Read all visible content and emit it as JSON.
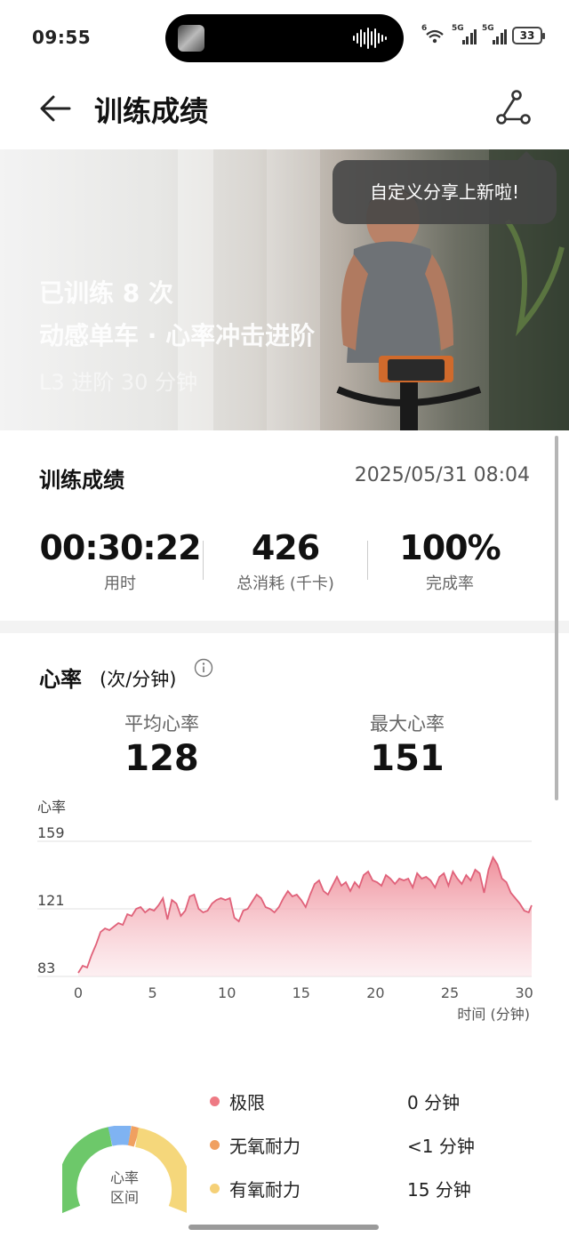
{
  "status_bar": {
    "time": "09:55",
    "net_small": "6",
    "sig1_label": "5G",
    "sig2_label": "5G",
    "battery": "33"
  },
  "header": {
    "title": "训练成绩"
  },
  "hero": {
    "line1": "已训练 8 次",
    "line2": "动感单车 · 心率冲击进阶",
    "line3": "L3 进阶  30 分钟",
    "tooltip": "自定义分享上新啦!"
  },
  "summary": {
    "title": "训练成绩",
    "datetime": "2025/05/31 08:04",
    "stats": [
      {
        "value": "00:30:22",
        "label": "用时"
      },
      {
        "value": "426",
        "label": "总消耗 (千卡)"
      },
      {
        "value": "100%",
        "label": "完成率"
      }
    ]
  },
  "heart_rate": {
    "title": "心率",
    "unit": "(次/分钟)",
    "avg_label": "平均心率",
    "avg_value": "128",
    "max_label": "最大心率",
    "max_value": "151"
  },
  "chart_data": {
    "type": "area",
    "ylabel": "心率",
    "xlabel": "时间 (分钟)",
    "yticks": [
      83,
      121,
      159
    ],
    "xticks": [
      0,
      5,
      10,
      15,
      20,
      25,
      30
    ],
    "xlim": [
      0,
      30.5
    ],
    "ylim": [
      83,
      159
    ],
    "color": "#e9707f",
    "x": [
      0,
      0.3,
      0.6,
      0.9,
      1.2,
      1.5,
      1.8,
      2.1,
      2.4,
      2.7,
      3.0,
      3.3,
      3.6,
      3.9,
      4.2,
      4.5,
      4.8,
      5.1,
      5.4,
      5.7,
      6.0,
      6.3,
      6.6,
      6.9,
      7.2,
      7.5,
      7.8,
      8.1,
      8.4,
      8.7,
      9.0,
      9.3,
      9.6,
      9.9,
      10.2,
      10.5,
      10.8,
      11.1,
      11.4,
      11.7,
      12.0,
      12.3,
      12.6,
      12.9,
      13.2,
      13.5,
      13.8,
      14.1,
      14.4,
      14.7,
      15.0,
      15.3,
      15.6,
      15.9,
      16.2,
      16.5,
      16.8,
      17.1,
      17.4,
      17.7,
      18.0,
      18.3,
      18.6,
      18.9,
      19.2,
      19.5,
      19.8,
      20.1,
      20.4,
      20.7,
      21.0,
      21.3,
      21.6,
      21.9,
      22.2,
      22.5,
      22.8,
      23.1,
      23.4,
      23.7,
      24.0,
      24.3,
      24.6,
      24.9,
      25.2,
      25.5,
      25.8,
      26.1,
      26.4,
      26.7,
      27.0,
      27.3,
      27.6,
      27.9,
      28.2,
      28.5,
      28.8,
      29.1,
      29.4,
      29.7,
      30.0,
      30.3,
      30.5
    ],
    "y": [
      85,
      89,
      88,
      95,
      101,
      108,
      110,
      109,
      111,
      113,
      112,
      118,
      117,
      121,
      122,
      119,
      121,
      120,
      123,
      127,
      115,
      126,
      124,
      117,
      120,
      128,
      129,
      121,
      119,
      120,
      124,
      126,
      127,
      126,
      127,
      116,
      114,
      120,
      121,
      125,
      129,
      127,
      122,
      121,
      119,
      122,
      127,
      131,
      128,
      129,
      126,
      122,
      129,
      135,
      137,
      131,
      129,
      134,
      139,
      134,
      136,
      131,
      136,
      133,
      140,
      142,
      137,
      136,
      134,
      140,
      138,
      135,
      138,
      137,
      138,
      133,
      141,
      138,
      139,
      137,
      133,
      139,
      141,
      134,
      142,
      138,
      135,
      140,
      137,
      143,
      141,
      130,
      143,
      150,
      146,
      138,
      136,
      130,
      127,
      124,
      120,
      119,
      123
    ]
  },
  "zones": {
    "center_line1": "心率",
    "center_line2": "区间",
    "items": [
      {
        "name": "极限",
        "value": "0 分钟",
        "color": "#ee7a84"
      },
      {
        "name": "无氧耐力",
        "value": "<1 分钟",
        "color": "#f0a060"
      },
      {
        "name": "有氧耐力",
        "value": "15 分钟",
        "color": "#f5d077"
      }
    ]
  }
}
